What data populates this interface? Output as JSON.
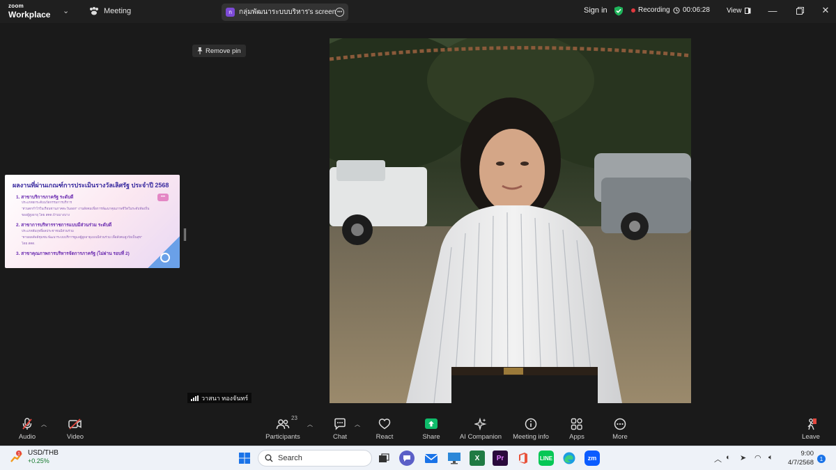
{
  "titlebar": {
    "brand_small": "zoom",
    "brand_main": "Workplace",
    "meeting_label": "Meeting",
    "share_badge": "ก",
    "share_tab_label": "กลุ่มพัฒนาระบบบริหาร's screen",
    "sign_in": "Sign in",
    "recording_label": "Recording",
    "timer": "00:06:28",
    "view_label": "View"
  },
  "stage": {
    "remove_pin": "Remove pin",
    "participant_name": "วาสนา ทองจันทร์",
    "thumbnail": {
      "title": "ผลงานที่ผ่านเกณฑ์การประเมินรางวัลเลิศรัฐ ประจำปี 2568",
      "item1": "1. สาขาบริการภาครัฐ ระดับดี",
      "item1_sub1": "ประเภทยกระดับนวัตกรรมการบริการ",
      "item1_sub2": "\"ส่วนตกกำไรในเรือนชานภาคตะวันออก\" งานสังคมเพื่อการพัฒนาคุณภาพชีวิตในระดับท้องถิ่น",
      "item1_sub3": "ของผู้สูงอายุ โดย สคด.บ้านบางบาง",
      "item2": "2. สาขาการบริหารราชการแบบมีส่วนร่วม ระดับดี",
      "item2_sub1": "ประเภทสัมฤทธิ์ผลประชาชนมีส่วนร่วม",
      "item2_sub2": "\"ตามผลลัพธ์ชุมชน พัฒนาระบบบริการดูแลผู้สูงอายุแบบมีส่วนร่วม เพื่อสังคมสูงวัยเป็นสุข\"",
      "item2_sub3": "โดย สคด.",
      "item3": "3. สาขาคุณภาพการบริหารจัดการภาครัฐ (ไม่ผ่าน รอบที่ 2)",
      "bubble": "•••"
    }
  },
  "toolbar": {
    "audio": "Audio",
    "video": "Video",
    "participants": "Participants",
    "participants_count": "23",
    "chat": "Chat",
    "react": "React",
    "share": "Share",
    "ai_companion": "AI Companion",
    "meeting_info": "Meeting info",
    "apps": "Apps",
    "more": "More",
    "leave": "Leave"
  },
  "taskbar": {
    "widget_badge": "1",
    "widget_symbol": "USD/THB",
    "widget_change": "+0.25%",
    "search_label": "Search",
    "time": "9:00",
    "date": "4/7/2568",
    "notification_count": "1"
  }
}
